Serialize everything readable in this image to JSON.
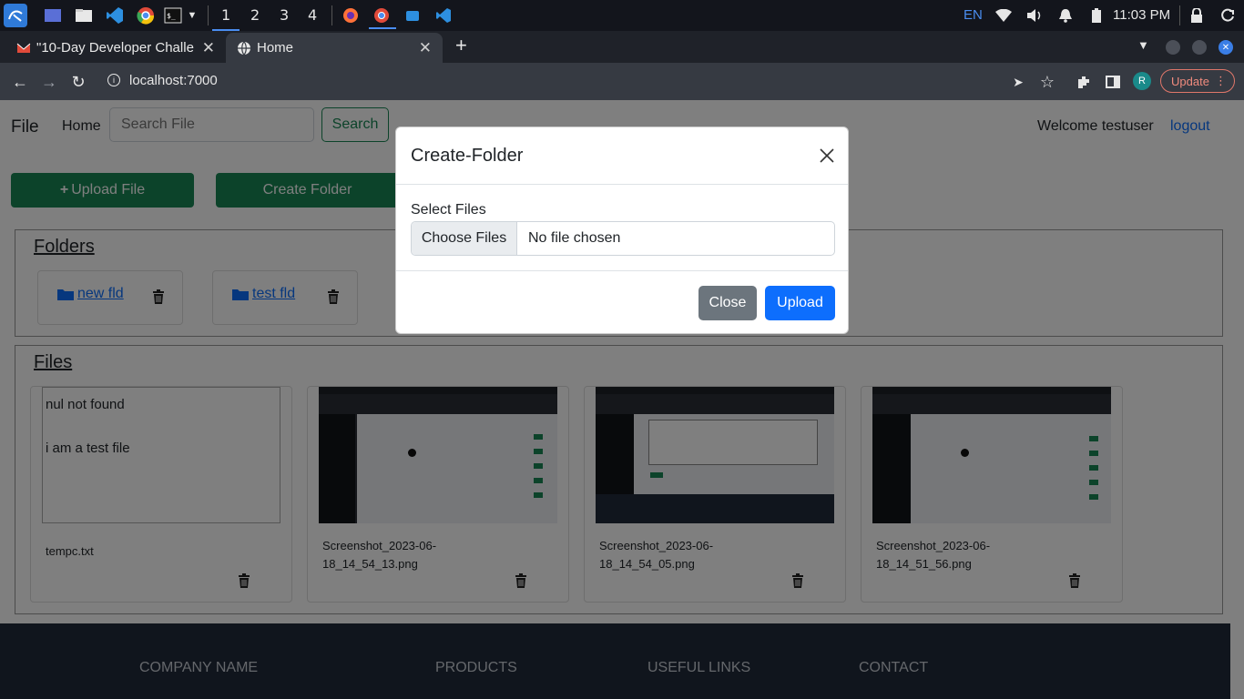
{
  "taskbar": {
    "workspaces": [
      "1",
      "2",
      "3",
      "4"
    ],
    "active_workspace": "1",
    "keyboard_layout": "EN",
    "time": "11:03 PM"
  },
  "browser": {
    "tabs": [
      {
        "title": "\"10-Day Developer Challe",
        "favicon": "gmail-icon",
        "active": false
      },
      {
        "title": "Home",
        "favicon": "globe-icon",
        "active": true
      }
    ],
    "new_tab_label": "+",
    "url": "localhost:7000",
    "profile_initial": "R",
    "update_label": "Update"
  },
  "navbar": {
    "brand": "File",
    "home_link": "Home",
    "search_placeholder": "Search File",
    "search_button": "Search",
    "welcome_text": "Welcome testuser",
    "logout_link": "logout"
  },
  "actions": {
    "upload_file": "Upload File",
    "create_folder": "Create Folder"
  },
  "folders": {
    "title": "Folders",
    "items": [
      {
        "name": "new fld"
      },
      {
        "name": "test fld"
      }
    ]
  },
  "files": {
    "title": "Files",
    "items": [
      {
        "name": "tempc.txt",
        "preview_text": "nul not found\n\ni am a test file",
        "type": "text"
      },
      {
        "name": "Screenshot_2023-06-18_14_54_13.png",
        "name_line1": "Screenshot_2023-06-",
        "name_line2": "18_14_54_13.png",
        "type": "image"
      },
      {
        "name": "Screenshot_2023-06-18_14_54_05.png",
        "name_line1": "Screenshot_2023-06-",
        "name_line2": "18_14_54_05.png",
        "type": "image"
      },
      {
        "name": "Screenshot_2023-06-18_14_51_56.png",
        "name_line1": "Screenshot_2023-06-",
        "name_line2": "18_14_51_56.png",
        "type": "image"
      }
    ]
  },
  "footer": {
    "columns": [
      "COMPANY NAME",
      "PRODUCTS",
      "USEFUL LINKS",
      "CONTACT"
    ]
  },
  "modal": {
    "title": "Create-Folder",
    "field_label": "Select Files",
    "choose_button": "Choose Files",
    "file_status": "No file chosen",
    "close_button": "Close",
    "upload_button": "Upload"
  },
  "colors": {
    "primary": "#0d6efd",
    "success": "#198754",
    "secondary": "#6c757d",
    "footer_bg": "#212a3a"
  }
}
